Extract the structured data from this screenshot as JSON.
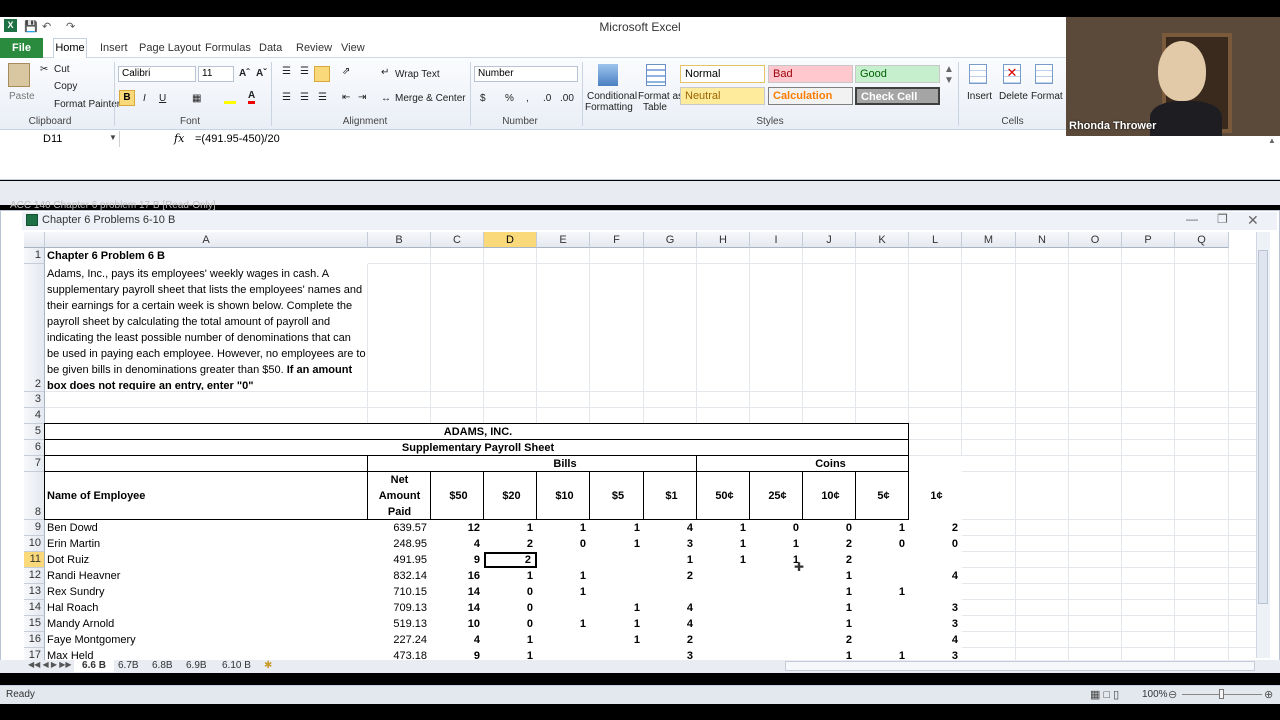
{
  "window": {
    "title": "Microsoft Excel"
  },
  "tabs": [
    "File",
    "Home",
    "Insert",
    "Page Layout",
    "Formulas",
    "Data",
    "Review",
    "View"
  ],
  "ribbon": {
    "clipboard": {
      "paste": "Paste",
      "cut": "Cut",
      "copy": "Copy",
      "format_painter": "Format Painter",
      "label": "Clipboard"
    },
    "font": {
      "name": "Calibri",
      "size": "11",
      "label": "Font"
    },
    "alignment": {
      "wrap": "Wrap Text",
      "merge": "Merge & Center",
      "label": "Alignment"
    },
    "number": {
      "format": "Number",
      "label": "Number"
    },
    "styles": {
      "conditional": "Conditional",
      "conditional2": "Formatting",
      "format_table": "Format as",
      "format_table2": "Table",
      "normal": "Normal",
      "bad": "Bad",
      "good": "Good",
      "neutral": "Neutral",
      "calculation": "Calculation",
      "check_cell": "Check Cell",
      "label": "Styles"
    },
    "cells": {
      "insert": "Insert",
      "delete": "Delete",
      "format": "Format",
      "label": "Cells"
    }
  },
  "formula_bar": {
    "name_box": "D11",
    "formula": "=(491.95-450)/20"
  },
  "background_window": {
    "title": "ACC 140 Chapter 6 problem 17 B  [Read-Only]"
  },
  "workbook": {
    "title": "Chapter 6 Problems 6-10 B"
  },
  "columns": [
    "A",
    "B",
    "C",
    "D",
    "E",
    "F",
    "G",
    "H",
    "I",
    "J",
    "K",
    "L",
    "M",
    "N",
    "O",
    "P",
    "Q"
  ],
  "rows": [
    "1",
    "2",
    "3",
    "4",
    "5",
    "6",
    "7",
    "8",
    "9",
    "10",
    "11",
    "12",
    "13",
    "14",
    "15",
    "16",
    "17"
  ],
  "sheet": {
    "a1": "Chapter 6 Problem 6 B",
    "a2_lines": [
      "Adams, Inc., pays its employees' weekly wages in cash. A",
      "supplementary payroll sheet that lists the employees' names and",
      "their earnings for a certain week is shown below. Complete the",
      "payroll sheet by calculating the total amount of payroll and",
      "indicating the least possible number of denominations that can",
      "be used in paying each employee. However, no employees are to"
    ],
    "a2_last": "be given bills in denominations greater than $50. ",
    "a2_bold1": "If an amount",
    "a2_bold2": "box does not require an entry, enter \"0\"",
    "company": "ADAMS, INC.",
    "subtitle": "Supplementary Payroll Sheet",
    "bills": "Bills",
    "coins": "Coins",
    "name_header": "Name of Employee",
    "net_header": [
      "Net",
      "Amount",
      "Paid"
    ],
    "denoms": [
      "$50",
      "$20",
      "$10",
      "$5",
      "$1",
      "50¢",
      "25¢",
      "10¢",
      "5¢",
      "1¢"
    ],
    "employees": [
      {
        "name": "Ben Dowd",
        "net": "639.57",
        "d": [
          "12",
          "1",
          "1",
          "1",
          "4",
          "1",
          "0",
          "0",
          "1",
          "2"
        ]
      },
      {
        "name": "Erin Martin",
        "net": "248.95",
        "d": [
          "4",
          "2",
          "0",
          "1",
          "3",
          "1",
          "1",
          "2",
          "0",
          "0"
        ]
      },
      {
        "name": "Dot Ruiz",
        "net": "491.95",
        "d": [
          "9",
          "2",
          "",
          "",
          "1",
          "1",
          "1",
          "2",
          "",
          ""
        ]
      },
      {
        "name": "Randi Heavner",
        "net": "832.14",
        "d": [
          "16",
          "1",
          "1",
          "",
          "2",
          "",
          "",
          "1",
          "",
          "4"
        ]
      },
      {
        "name": "Rex Sundry",
        "net": "710.15",
        "d": [
          "14",
          "0",
          "1",
          "",
          "",
          "",
          "",
          "1",
          "1",
          ""
        ]
      },
      {
        "name": "Hal Roach",
        "net": "709.13",
        "d": [
          "14",
          "0",
          "",
          "1",
          "4",
          "",
          "",
          "1",
          "",
          "3"
        ]
      },
      {
        "name": "Mandy Arnold",
        "net": "519.13",
        "d": [
          "10",
          "0",
          "1",
          "1",
          "4",
          "",
          "",
          "1",
          "",
          "3"
        ]
      },
      {
        "name": "Faye Montgomery",
        "net": "227.24",
        "d": [
          "4",
          "1",
          "",
          "1",
          "2",
          "",
          "",
          "2",
          "",
          "4"
        ]
      },
      {
        "name": "Max Held",
        "net": "473.18",
        "d": [
          "9",
          "1",
          "",
          "",
          "3",
          "",
          "",
          "1",
          "1",
          "3"
        ]
      }
    ]
  },
  "sheet_tabs": [
    "6.6 B",
    "6.7B",
    "6.8B",
    "6.9B",
    "6.10 B"
  ],
  "status": {
    "ready": "Ready",
    "zoom": "100%"
  },
  "webcam": {
    "name": "Rhonda Thrower"
  }
}
